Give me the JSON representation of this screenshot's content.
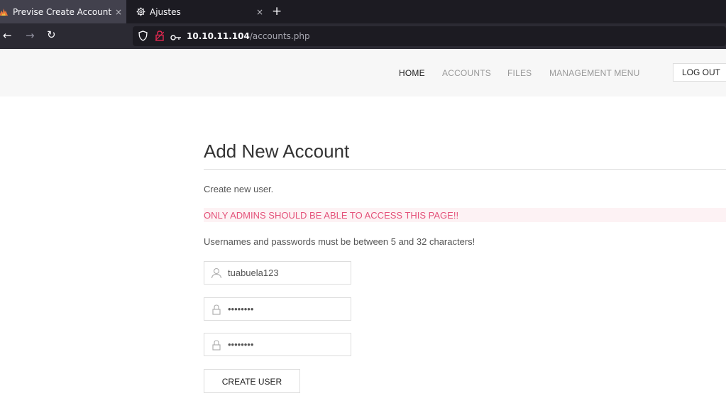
{
  "browser": {
    "tabs": [
      {
        "title": "Previse Create Account",
        "icon": "flame-favicon-icon",
        "active": true
      },
      {
        "title": "Ajustes",
        "icon": "gear-icon",
        "active": false
      }
    ],
    "close_glyph": "×",
    "new_tab_glyph": "+",
    "url_host": "10.10.11.104",
    "url_path": "/accounts.php"
  },
  "site_nav": {
    "items": [
      "HOME",
      "ACCOUNTS",
      "FILES",
      "MANAGEMENT MENU"
    ],
    "active_item": "HOME",
    "logout_label": "LOG OUT"
  },
  "page": {
    "title": "Add New Account",
    "intro": "Create new user.",
    "warning": "ONLY ADMINS SHOULD BE ABLE TO ACCESS THIS PAGE!!",
    "rules_note": "Usernames and passwords must be between 5 and 32 characters!"
  },
  "form": {
    "username_value": "tuabuela123",
    "password_value": "tuabuela",
    "confirm_value": "tuabuela",
    "submit_label": "CREATE USER"
  },
  "colors": {
    "warning_text": "#e4527a",
    "warning_bg": "#fdf2f4",
    "header_bg": "#f7f7f7"
  }
}
